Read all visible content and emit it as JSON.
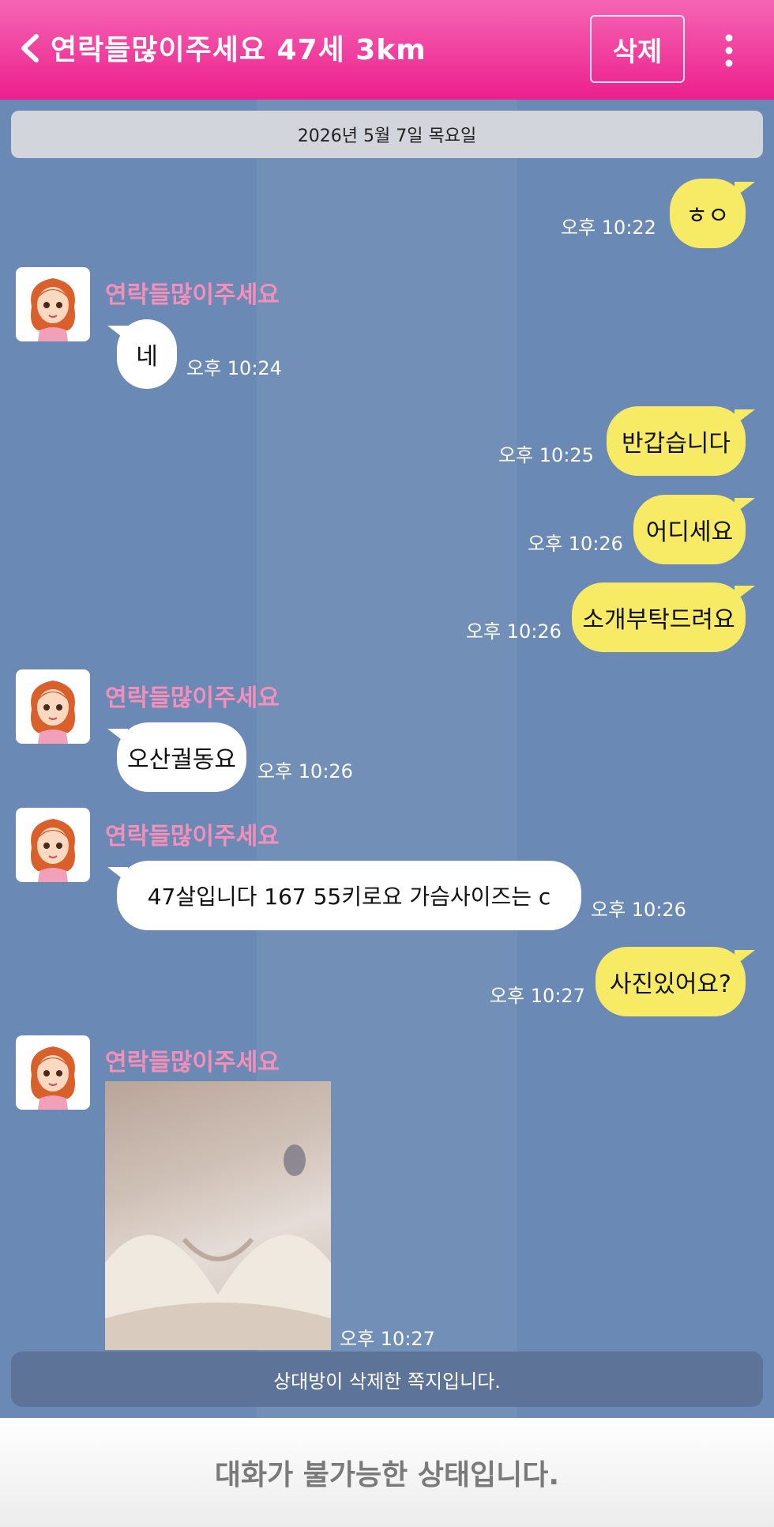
{
  "header": {
    "title": "연락들많이주세요 47세 3km",
    "delete_label": "삭제",
    "background": "#ec1f8c"
  },
  "chat": {
    "date": "2026년 5월 7일 목요일",
    "messages": [
      {
        "from": "me",
        "text": "ㅎㅇ",
        "time": "오후 10:22"
      },
      {
        "from": "other",
        "sender": "연락들많이주세요",
        "text": "네",
        "time": "오후 10:24"
      },
      {
        "from": "me",
        "text": "반갑습니다",
        "time": "오후 10:25"
      },
      {
        "from": "me",
        "text": "어디세요",
        "time": "오후 10:26"
      },
      {
        "from": "me",
        "text": "소개부탁드려요",
        "time": "오후 10:26"
      },
      {
        "from": "other",
        "sender": "연락들많이주세요",
        "text": "오산궐동요",
        "time": "오후 10:26"
      },
      {
        "from": "other",
        "sender": "연락들많이주세요",
        "text": "47살입니다 167 55키로요 가슴사이즈는 c",
        "time": "오후 10:26"
      },
      {
        "from": "me",
        "text": "사진있어요?",
        "time": "오후 10:27"
      },
      {
        "from": "other",
        "sender": "연락들많이주세요",
        "type": "photo",
        "time": "오후 10:27"
      }
    ],
    "deleted_notice": "상대방이 삭제한 쪽지입니다.",
    "my_bubble_color": "#f7ea64",
    "other_bubble_color": "#ffffff",
    "sender_name_color": "#f48fb9"
  },
  "footer": {
    "status": "대화가 불가능한 상태입니다."
  }
}
